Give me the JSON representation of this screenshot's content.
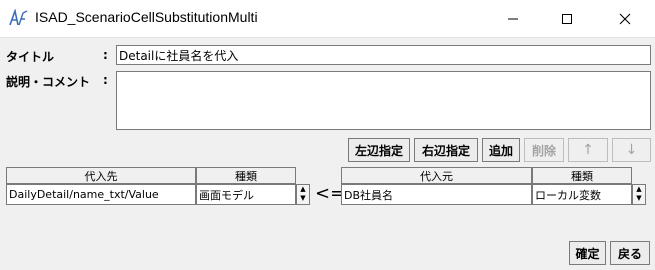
{
  "window": {
    "title": "ISAD_ScenarioCellSubstitutionMulti",
    "logo_icon": "isad-logo-icon",
    "controls": [
      "minimize-icon",
      "maximize-icon",
      "close-icon"
    ]
  },
  "form": {
    "title_label": "タイトル",
    "title_colon": ":",
    "title_value": "Detailに社員名を代入",
    "comment_label": "説明・コメント",
    "comment_colon": ":",
    "comment_value": ""
  },
  "toolbar": {
    "left_assign": "左辺指定",
    "right_assign": "右辺指定",
    "add": "追加",
    "delete": "削除",
    "up": "↑",
    "down": "↓"
  },
  "target_table": {
    "headers": [
      "代入先",
      "種類"
    ],
    "row": [
      "DailyDetail/name_txt/Value",
      "画面モデル"
    ]
  },
  "assign_arrow": "<=",
  "source_table": {
    "headers": [
      "代入元",
      "種類"
    ],
    "row": [
      "DB社員名",
      "ローカル変数"
    ]
  },
  "footer": {
    "ok": "確定",
    "back": "戻る"
  }
}
